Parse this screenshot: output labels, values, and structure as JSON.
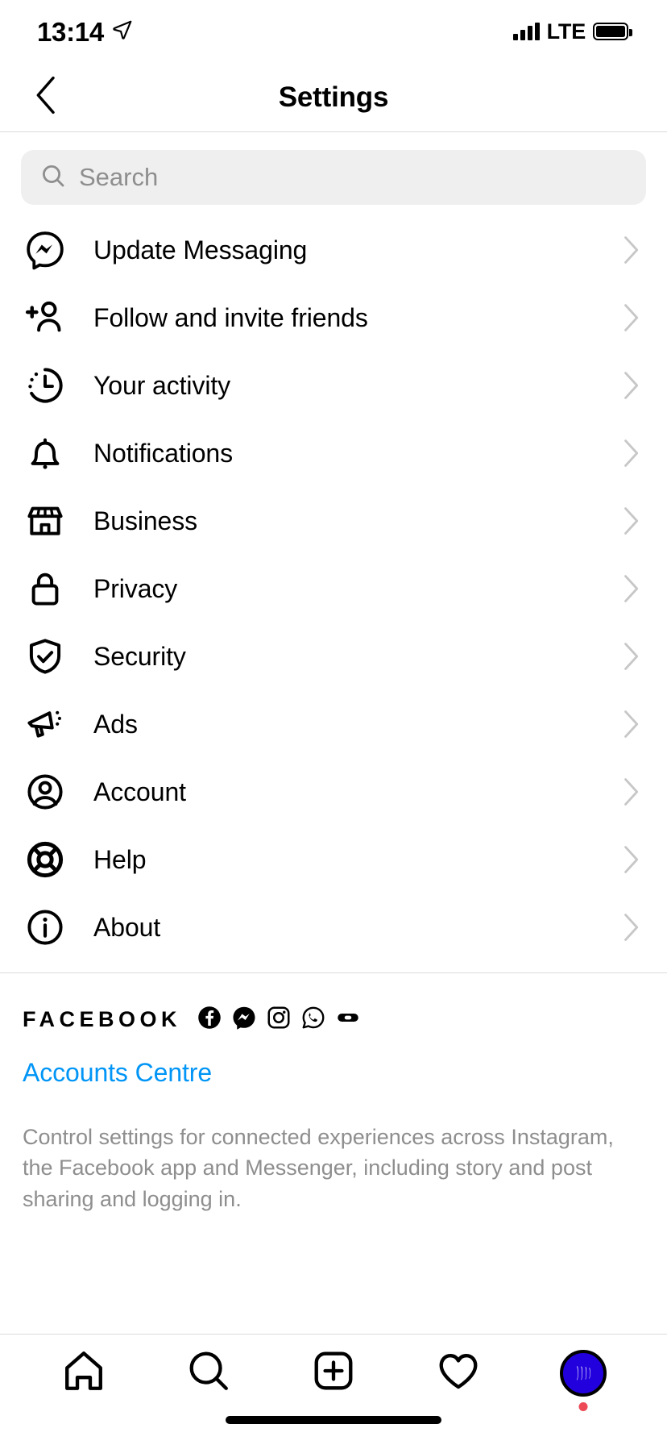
{
  "status_bar": {
    "time": "13:14",
    "location_icon": "location-arrow-icon",
    "network": "LTE",
    "signal_icon": "signal-bars-icon",
    "battery_icon": "battery-full-icon"
  },
  "header": {
    "back_icon": "chevron-left-icon",
    "title": "Settings"
  },
  "search": {
    "icon": "search-icon",
    "placeholder": "Search",
    "value": ""
  },
  "menu": {
    "items": [
      {
        "label": "Update Messaging",
        "icon": "messenger-icon",
        "chevron": "chevron-right-icon"
      },
      {
        "label": "Follow and invite friends",
        "icon": "person-plus-icon",
        "chevron": "chevron-right-icon"
      },
      {
        "label": "Your activity",
        "icon": "clock-activity-icon",
        "chevron": "chevron-right-icon"
      },
      {
        "label": "Notifications",
        "icon": "bell-icon",
        "chevron": "chevron-right-icon"
      },
      {
        "label": "Business",
        "icon": "storefront-icon",
        "chevron": "chevron-right-icon"
      },
      {
        "label": "Privacy",
        "icon": "lock-icon",
        "chevron": "chevron-right-icon"
      },
      {
        "label": "Security",
        "icon": "shield-check-icon",
        "chevron": "chevron-right-icon"
      },
      {
        "label": "Ads",
        "icon": "megaphone-icon",
        "chevron": "chevron-right-icon"
      },
      {
        "label": "Account",
        "icon": "person-circle-icon",
        "chevron": "chevron-right-icon"
      },
      {
        "label": "Help",
        "icon": "life-ring-icon",
        "chevron": "chevron-right-icon"
      },
      {
        "label": "About",
        "icon": "info-circle-icon",
        "chevron": "chevron-right-icon"
      }
    ]
  },
  "facebook_section": {
    "brand": "FACEBOOK",
    "app_icons": [
      "facebook-icon",
      "messenger-icon",
      "instagram-icon",
      "whatsapp-icon",
      "oculus-icon"
    ],
    "link": "Accounts Centre",
    "link_color": "#0095f6",
    "description": "Control settings for connected experiences across Instagram, the Facebook app and Messenger, including story and post sharing and logging in."
  },
  "tab_bar": {
    "tabs": [
      {
        "name": "home",
        "icon": "home-icon"
      },
      {
        "name": "search",
        "icon": "search-icon"
      },
      {
        "name": "create",
        "icon": "plus-square-icon"
      },
      {
        "name": "activity",
        "icon": "heart-icon"
      },
      {
        "name": "profile",
        "icon": "profile-avatar-icon"
      }
    ],
    "profile_badge_color": "#ed4956",
    "avatar_color": "#2200dd"
  }
}
